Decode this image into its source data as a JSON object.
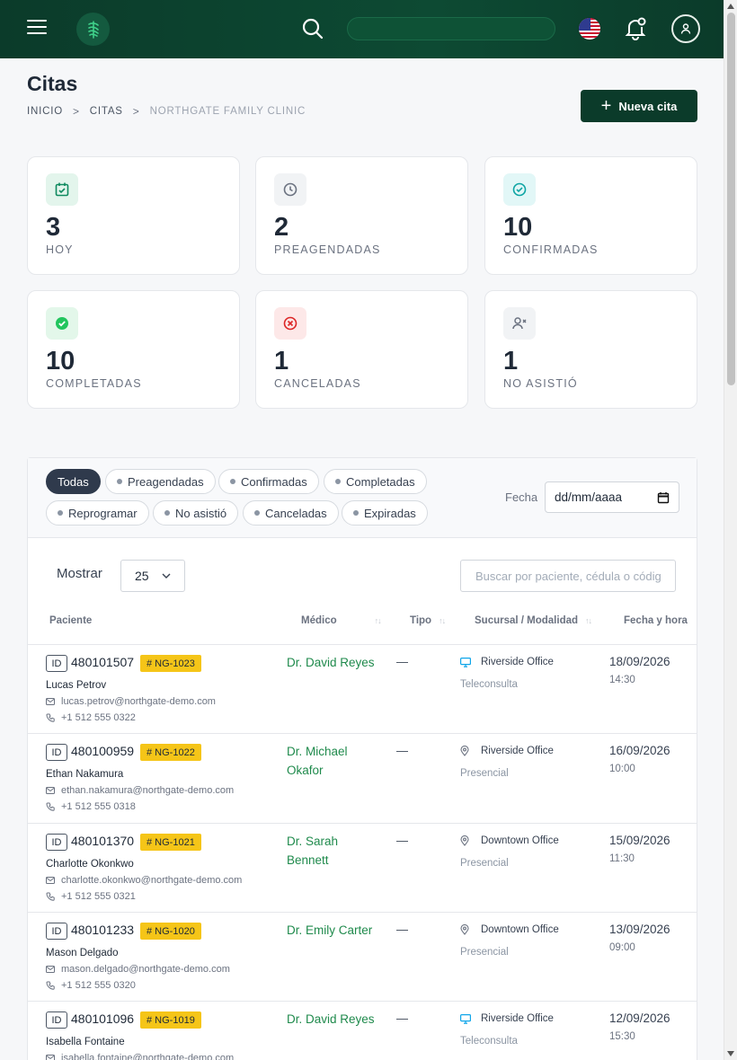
{
  "header": {
    "search_aria": "search",
    "language": "en-US"
  },
  "page": {
    "title": "Citas",
    "breadcrumb": [
      "INICIO",
      "CITAS",
      "NORTHGATE FAMILY CLINIC"
    ],
    "new_button": "Nueva cita"
  },
  "stats": [
    {
      "value": "3",
      "label": "HOY",
      "icon": "calendar-check-icon",
      "color": "#0f8a5f"
    },
    {
      "value": "2",
      "label": "PREAGENDADAS",
      "icon": "clock-icon",
      "color": "#6b7280"
    },
    {
      "value": "10",
      "label": "CONFIRMADAS",
      "icon": "check-circle-icon",
      "color": "#0ea5a4"
    },
    {
      "value": "10",
      "label": "COMPLETADAS",
      "icon": "check-filled-icon",
      "color": "#16a34a"
    },
    {
      "value": "1",
      "label": "CANCELADAS",
      "icon": "x-circle-icon",
      "color": "#dc2626"
    },
    {
      "value": "1",
      "label": "NO ASISTIÓ",
      "icon": "user-x-icon",
      "color": "#6b7280"
    }
  ],
  "filters": {
    "chips": [
      "Todas",
      "Preagendadas",
      "Confirmadas",
      "Completadas",
      "Reprogramar",
      "No asistió",
      "Canceladas",
      "Expiradas"
    ],
    "active": "Todas",
    "date_label": "Fecha",
    "date_placeholder": "dd/mm/aaaa"
  },
  "table": {
    "show_label": "Mostrar",
    "page_size": "25",
    "search_placeholder": "Buscar por paciente, cédula o código",
    "columns": [
      "Paciente",
      "Médico",
      "Tipo",
      "Sucursal / Modalidad",
      "Fecha y hora"
    ],
    "rows": [
      {
        "id_label": "ID",
        "id": "480101507",
        "code": "# NG-1023",
        "name": "Lucas Petrov",
        "email": "lucas.petrov@northgate-demo.com",
        "phone": "+1 512 555 0322",
        "doctor": "Dr. David Reyes",
        "tipo": "—",
        "office": "Riverside Office",
        "office_icon": "monitor-icon",
        "mode": "Teleconsulta",
        "date": "18/09/2026",
        "time": "14:30"
      },
      {
        "id_label": "ID",
        "id": "480100959",
        "code": "# NG-1022",
        "name": "Ethan Nakamura",
        "email": "ethan.nakamura@northgate-demo.com",
        "phone": "+1 512 555 0318",
        "doctor": "Dr. Michael Okafor",
        "tipo": "—",
        "office": "Riverside Office",
        "office_icon": "map-pin-icon",
        "mode": "Presencial",
        "date": "16/09/2026",
        "time": "10:00"
      },
      {
        "id_label": "ID",
        "id": "480101370",
        "code": "# NG-1021",
        "name": "Charlotte Okonkwo",
        "email": "charlotte.okonkwo@northgate-demo.com",
        "phone": "+1 512 555 0321",
        "doctor": "Dr. Sarah Bennett",
        "tipo": "—",
        "office": "Downtown Office",
        "office_icon": "map-pin-icon",
        "mode": "Presencial",
        "date": "15/09/2026",
        "time": "11:30"
      },
      {
        "id_label": "ID",
        "id": "480101233",
        "code": "# NG-1020",
        "name": "Mason Delgado",
        "email": "mason.delgado@northgate-demo.com",
        "phone": "+1 512 555 0320",
        "doctor": "Dr. Emily Carter",
        "tipo": "—",
        "office": "Downtown Office",
        "office_icon": "map-pin-icon",
        "mode": "Presencial",
        "date": "13/09/2026",
        "time": "09:00"
      },
      {
        "id_label": "ID",
        "id": "480101096",
        "code": "# NG-1019",
        "name": "Isabella Fontaine",
        "email": "isabella.fontaine@northgate-demo.com",
        "phone": "",
        "doctor": "Dr. David Reyes",
        "tipo": "—",
        "office": "Riverside Office",
        "office_icon": "monitor-icon",
        "mode": "Teleconsulta",
        "date": "12/09/2026",
        "time": "15:30"
      }
    ]
  }
}
